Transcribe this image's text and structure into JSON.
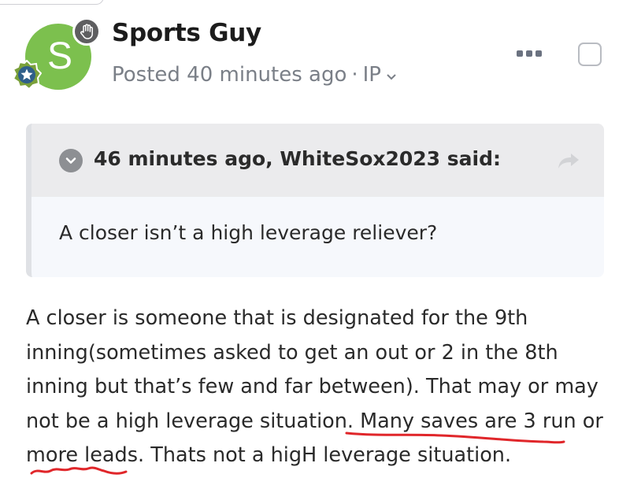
{
  "author": {
    "name": "Sports Guy",
    "avatar_letter": "S",
    "avatar_color": "#7cc04e",
    "badge_icon": "star-badge-icon",
    "role_icon": "hand-icon"
  },
  "post_meta": {
    "posted": "Posted 40 minutes ago",
    "separator": "·",
    "ip_label": "IP"
  },
  "quote": {
    "citation": "46 minutes ago, WhiteSox2023 said:",
    "text": "A closer isn’t a high leverage reliever?"
  },
  "post": {
    "body": "A closer is someone that is designated for the 9th inning(sometimes asked to get an out or 2 in the 8th inning but that’s few and far between). That may or may not be a high leverage situation. Many saves are 3 run or more leads. Thats not a higH leverage situation."
  },
  "colors": {
    "meta_text": "#7a7f87",
    "quote_header_bg": "#ebebed",
    "quote_body_bg": "#f6f8fc",
    "annotation_red": "#e0262a"
  }
}
